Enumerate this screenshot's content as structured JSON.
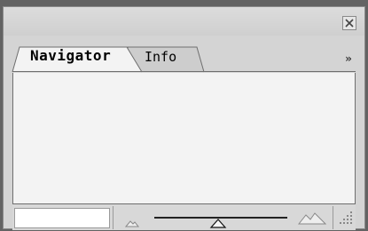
{
  "panel": {
    "tabs": [
      {
        "label": "Navigator",
        "active": true
      },
      {
        "label": "Info",
        "active": false
      }
    ],
    "menu_glyph": "»",
    "close_glyph": "X"
  },
  "bottom": {
    "zoom_value": "",
    "zoom_level": 0.5
  },
  "icons": {
    "close": "close-icon",
    "menu": "panel-menu-icon",
    "zoom_out": "zoom-out-mountain-icon",
    "zoom_in": "zoom-in-mountain-icon",
    "grip": "resize-grip-icon"
  },
  "colors": {
    "background": "#636363",
    "panel": "#d4d4d4",
    "preview": "#f3f3f3"
  }
}
